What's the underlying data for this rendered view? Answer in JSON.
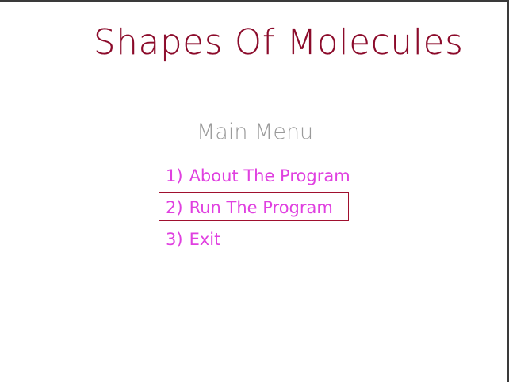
{
  "app": {
    "title": "Shapes Of Molecules"
  },
  "menu": {
    "heading": "Main Menu",
    "items": [
      {
        "number": "1)",
        "label": "About The Program"
      },
      {
        "number": "2)",
        "label": "Run The Program"
      },
      {
        "number": "3)",
        "label": "Exit"
      }
    ],
    "selected_index": 1
  },
  "colors": {
    "title": "#8b0a2a",
    "heading": "#9a9a9a",
    "menu_item": "#e040e0",
    "selection_border": "#a0102e",
    "background": "#ffffff"
  }
}
